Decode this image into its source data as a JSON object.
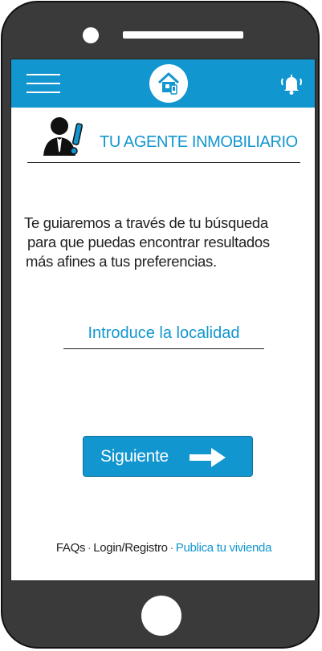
{
  "header": {
    "title": "TU AGENTE INMOBILIARIO"
  },
  "icons": {
    "menu": "hamburger-menu-icon",
    "home": "house-logo-icon",
    "notifications": "bell-icon",
    "agent": "agent-avatar-icon",
    "arrow": "arrow-right-icon"
  },
  "intro": {
    "lines": [
      "Te guiaremos a través de tu búsqueda",
      "para que puedas encontrar resultados",
      "más afines a tus preferencias."
    ]
  },
  "search": {
    "placeholder": "Introduce la localidad",
    "value": ""
  },
  "actions": {
    "next_label": "Siguiente"
  },
  "footer": {
    "faqs": "FAQs",
    "login": "Login/Registro",
    "publish": "Publica tu vivienda",
    "separator": "·"
  },
  "colors": {
    "accent": "#1296cf",
    "phone_body": "#3a3a3a",
    "text": "#222222"
  }
}
